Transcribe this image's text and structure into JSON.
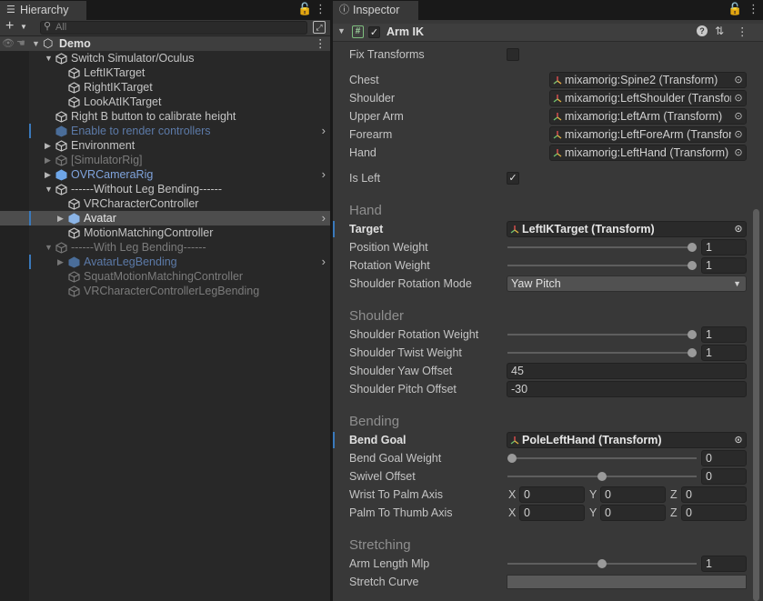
{
  "hierarchy": {
    "tab": "Hierarchy",
    "search_placeholder": "All",
    "scene": "Demo",
    "rows": [
      {
        "label": "Switch Simulator/Oculus"
      },
      {
        "label": "LeftIKTarget"
      },
      {
        "label": "RightIKTarget"
      },
      {
        "label": "LookAtIKTarget"
      },
      {
        "label": "Right B button to calibrate height"
      },
      {
        "label": "Enable to render controllers"
      },
      {
        "label": "Environment"
      },
      {
        "label": "[SimulatorRig]"
      },
      {
        "label": "OVRCameraRig"
      },
      {
        "label": "------Without Leg Bending------"
      },
      {
        "label": "VRCharacterController"
      },
      {
        "label": "Avatar"
      },
      {
        "label": "MotionMatchingController"
      },
      {
        "label": "------With Leg Bending------"
      },
      {
        "label": "AvatarLegBending"
      },
      {
        "label": "SquatMotionMatchingController"
      },
      {
        "label": "VRCharacterControllerLegBending"
      }
    ]
  },
  "inspector": {
    "tab": "Inspector",
    "component": "Arm IK",
    "component_icon": "#",
    "fix_transforms": "Fix Transforms",
    "fields": [
      {
        "label": "Chest",
        "value": "mixamorig:Spine2 (Transform)"
      },
      {
        "label": "Shoulder",
        "value": "mixamorig:LeftShoulder (Transform)"
      },
      {
        "label": "Upper Arm",
        "value": "mixamorig:LeftArm (Transform)"
      },
      {
        "label": "Forearm",
        "value": "mixamorig:LeftForeArm (Transform)"
      },
      {
        "label": "Hand",
        "value": "mixamorig:LeftHand (Transform)"
      }
    ],
    "is_left": "Is Left",
    "hand": {
      "title": "Hand",
      "target_label": "Target",
      "target_value": "LeftIKTarget (Transform)",
      "position_weight_label": "Position Weight",
      "position_weight": "1",
      "position_weight_level": 1,
      "rotation_weight_label": "Rotation Weight",
      "rotation_weight": "1",
      "rotation_weight_level": 1,
      "shoulder_rotation_mode_label": "Shoulder Rotation Mode",
      "shoulder_rotation_mode": "Yaw Pitch"
    },
    "shoulder": {
      "title": "Shoulder",
      "rotation_weight_label": "Shoulder Rotation Weight",
      "rotation_weight": "1",
      "rotation_weight_level": 1,
      "twist_weight_label": "Shoulder Twist Weight",
      "twist_weight": "1",
      "twist_weight_level": 1,
      "yaw_offset_label": "Shoulder Yaw Offset",
      "yaw_offset": "45",
      "pitch_offset_label": "Shoulder Pitch Offset",
      "pitch_offset": "-30"
    },
    "bending": {
      "title": "Bending",
      "bend_goal_label": "Bend Goal",
      "bend_goal_value": "PoleLeftHand (Transform)",
      "bend_goal_weight_label": "Bend Goal Weight",
      "bend_goal_weight": "0",
      "bend_goal_weight_level": 0,
      "swivel_offset_label": "Swivel Offset",
      "swivel_offset": "0",
      "swivel_offset_level": 0.5,
      "wrist_to_palm_label": "Wrist To Palm Axis",
      "wrist_to_palm": {
        "x": "0",
        "y": "0",
        "z": "0"
      },
      "palm_to_thumb_label": "Palm To Thumb Axis",
      "palm_to_thumb": {
        "x": "0",
        "y": "0",
        "z": "0"
      },
      "axis_labels": {
        "x": "X",
        "y": "Y",
        "z": "Z"
      }
    },
    "stretching": {
      "title": "Stretching",
      "arm_length_label": "Arm Length Mlp",
      "arm_length": "1",
      "arm_length_level": 0.5,
      "stretch_curve_label": "Stretch Curve"
    }
  }
}
